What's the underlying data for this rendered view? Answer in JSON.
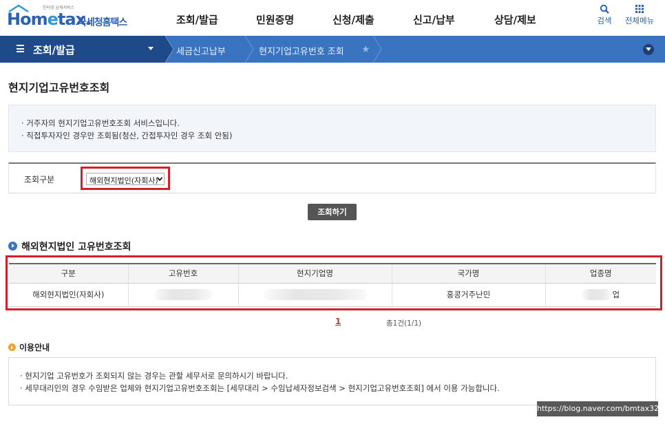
{
  "header": {
    "logo_tagline": "인터넷 납세서비스",
    "logo_brand_a": "Hom",
    "logo_brand_e": "e",
    "logo_brand_b": "tax.",
    "logo_org": "국세청홈택스",
    "menu": [
      "조회/발급",
      "민원증명",
      "신청/제출",
      "신고/납부",
      "상담/제보"
    ],
    "search_label": "검색",
    "all_menu_label": "전체메뉴"
  },
  "navbar": {
    "section": "조회/발급",
    "breadcrumb": [
      "세금신고납부",
      "현지기업고유번호 조회"
    ]
  },
  "page": {
    "title": "현지기업고유번호조회",
    "info_lines": [
      "· 거주자의 현지기업고유번호조회 서비스입니다.",
      "· 직접투자자인 경우만 조회됨(청산, 간접투자인 경우 조회 안됨)"
    ]
  },
  "search": {
    "label": "조회구분",
    "selected": "해외현지법인(자회사)",
    "button": "조회하기"
  },
  "result": {
    "section_title": "해외현지법인 고유번호조회",
    "columns": [
      "구분",
      "고유번호",
      "현지기업명",
      "국가명",
      "업종명"
    ],
    "rows": [
      {
        "type": "해외현지법인(자회사)",
        "id": "",
        "name": "",
        "country": "홍콩거주난민",
        "industry": "업"
      }
    ],
    "page": "1",
    "count": "총1건(1/1)"
  },
  "notice": {
    "title": "이용안내",
    "lines": [
      "· 현지기업 고유번호가 조회되지 않는 경우는 관할 세무서로 문의하시기 바랍니다.",
      "· 세무대리인의 경우 수임받은 업체와 현지기업고유번호조회는 [세무대리 > 수임납세자정보검색 > 현지기업고유번호조회] 에서 이용 가능합니다."
    ]
  },
  "watermark": "https://blog.naver.com/bmtax32",
  "colors": {
    "brand": "#2b62b6",
    "nav": "#3a73c0",
    "nav_dark": "#1e4a8a",
    "highlight": "#d31f2a"
  }
}
